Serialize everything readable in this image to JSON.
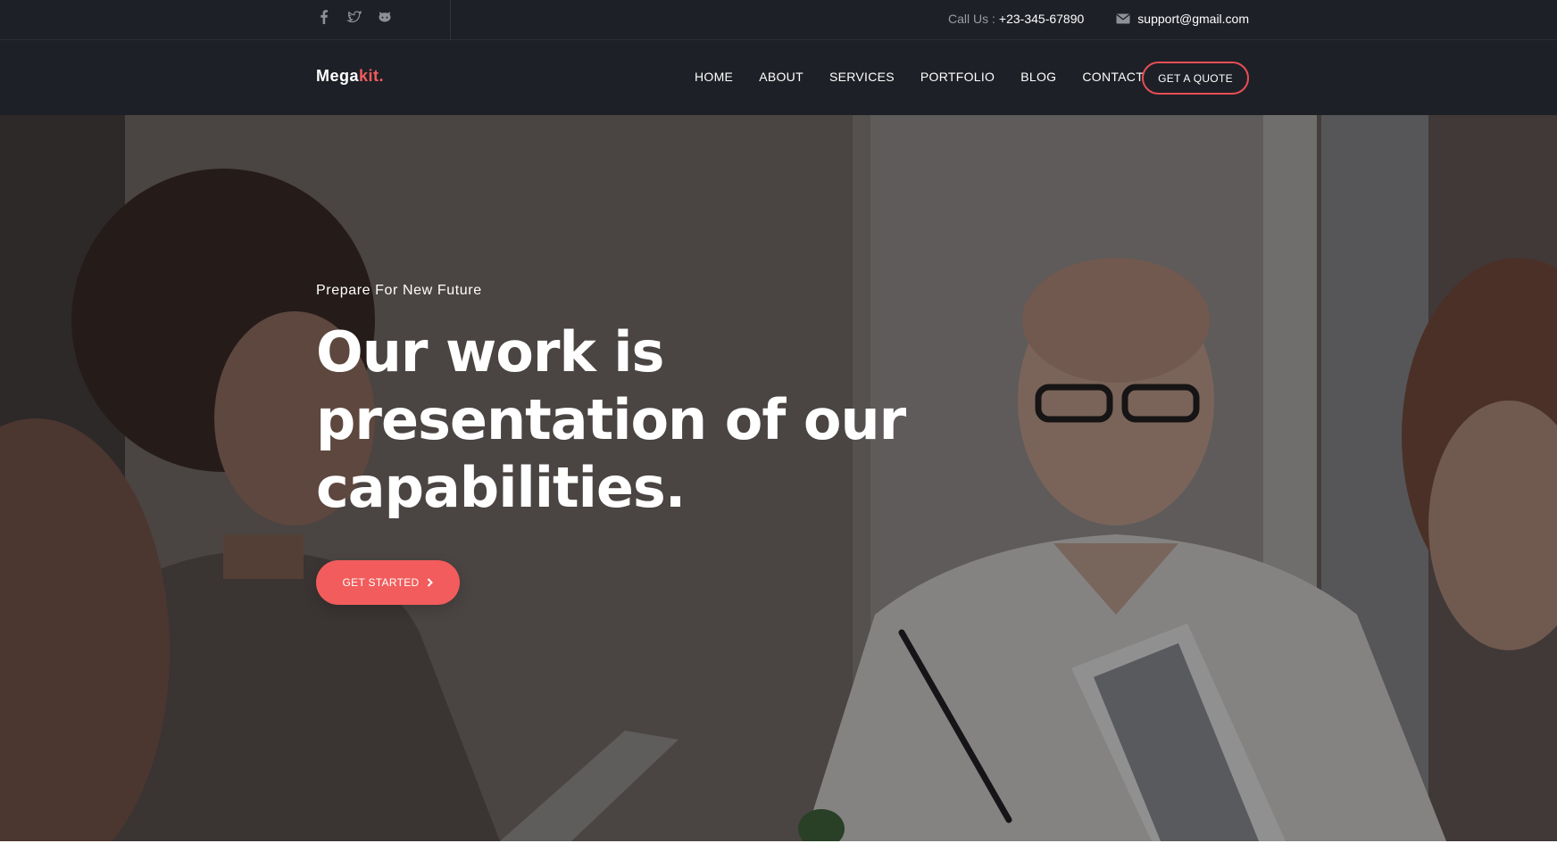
{
  "topbar": {
    "social_icons": [
      "facebook-icon",
      "twitter-icon",
      "github-icon"
    ],
    "call_label": "Call Us :",
    "call_number": "+23-345-67890",
    "email_icon": "envelope-icon",
    "email": "support@gmail.com"
  },
  "nav": {
    "logo_main": "Mega",
    "logo_accent": "kit.",
    "links": [
      "HOME",
      "ABOUT",
      "SERVICES",
      "PORTFOLIO",
      "BLOG",
      "CONTACT"
    ],
    "cta_label": "GET A QUOTE"
  },
  "hero": {
    "eyebrow": "Prepare For New Future",
    "title": "Our work is presentation of our capabilities.",
    "cta_label": "GET STARTED",
    "cta_icon": "chevron-right-icon"
  },
  "colors": {
    "accent": "#f25c5c",
    "bar_background": "#1e2027",
    "text_light": "#ffffff",
    "text_muted": "#9a9ca3"
  }
}
